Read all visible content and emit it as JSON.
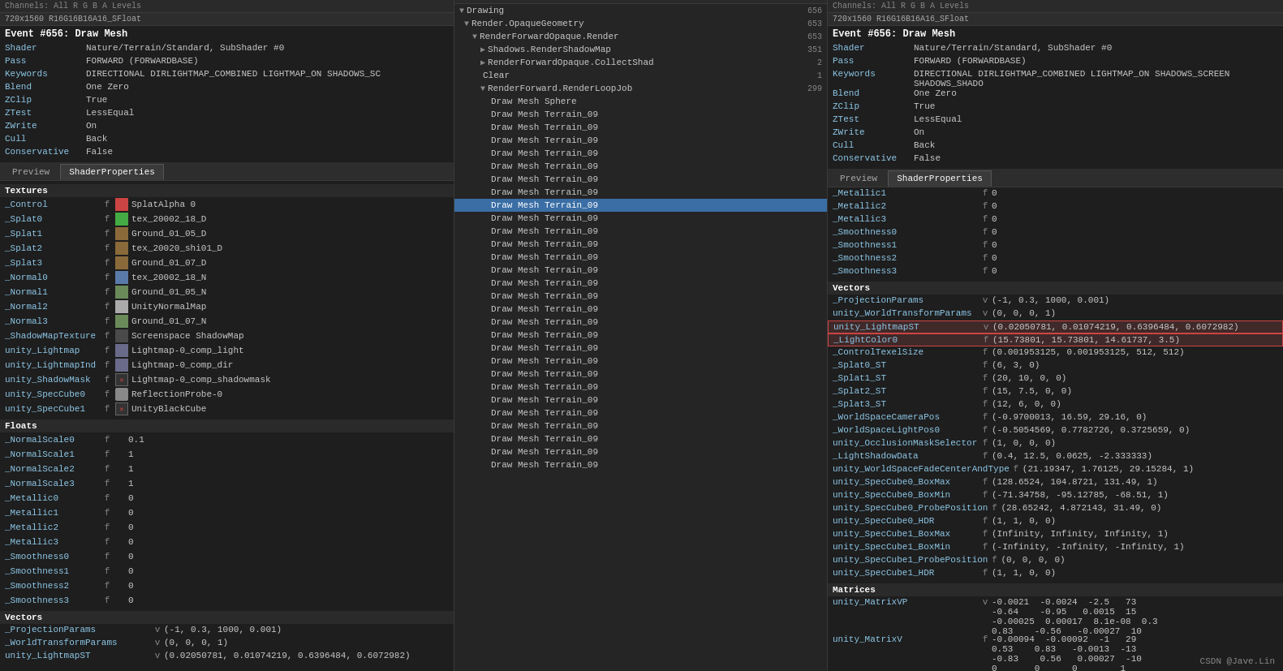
{
  "left": {
    "channelBar": "Channels: All  R  G  B  A  Levels",
    "resolution": "720x1560 R16G16B16A16_SFloat",
    "eventTitle": "Event #656: Draw Mesh",
    "properties": [
      {
        "key": "Shader",
        "val": "Nature/Terrain/Standard, SubShader #0"
      },
      {
        "key": "Pass",
        "val": "FORWARD (FORWARDBASE)"
      },
      {
        "key": "Keywords",
        "val": "DIRECTIONAL DIRLIGHTMAP_COMBINED LIGHTMAP_ON SHADOWS_SC"
      },
      {
        "key": "Blend",
        "val": "One Zero"
      },
      {
        "key": "ZClip",
        "val": "True"
      },
      {
        "key": "ZTest",
        "val": "LessEqual"
      },
      {
        "key": "ZWrite",
        "val": "On"
      },
      {
        "key": "Cull",
        "val": "Back"
      },
      {
        "key": "Conservative",
        "val": "False"
      }
    ],
    "tabs": [
      "Preview",
      "ShaderProperties"
    ],
    "activeTab": "ShaderProperties",
    "sections": {
      "textures": {
        "label": "Textures",
        "items": [
          {
            "name": "_Control",
            "type": "f",
            "thumb": "red",
            "val": "SplatAlpha 0"
          },
          {
            "name": "_Splat0",
            "type": "f",
            "thumb": "green",
            "val": "tex_20002_18_D"
          },
          {
            "name": "_Splat1",
            "type": "f",
            "thumb": "brown",
            "val": "Ground_01_05_D"
          },
          {
            "name": "_Splat2",
            "type": "f",
            "thumb": "brown2",
            "val": "tex_20020_shi01_D"
          },
          {
            "name": "_Splat3",
            "type": "f",
            "thumb": "brown3",
            "val": "Ground_01_07_D"
          },
          {
            "name": "_Normal0",
            "type": "f",
            "thumb": "blue",
            "val": "tex_20002_18_N"
          },
          {
            "name": "_Normal1",
            "type": "f",
            "thumb": "green2",
            "val": "Ground_01_05_N"
          },
          {
            "name": "_Normal2",
            "type": "f",
            "thumb": "gray",
            "val": "UnityNormalMap"
          },
          {
            "name": "_Normal3",
            "type": "f",
            "thumb": "gray2",
            "val": "Ground_01_07_N"
          },
          {
            "name": "_ShadowMapTexture",
            "type": "f",
            "thumb": "shadow",
            "val": "Screenspace ShadowMap"
          },
          {
            "name": "unity_Lightmap",
            "type": "f",
            "thumb": "lightmap",
            "val": "Lightmap-0_comp_light"
          },
          {
            "name": "unity_LightmapInd",
            "type": "f",
            "thumb": "lightmapdir",
            "val": "Lightmap-0_comp_dir"
          },
          {
            "name": "unity_ShadowMask",
            "type": "f",
            "thumb": "shadowmask",
            "val": "Lightmap-0_comp_shadowmask"
          },
          {
            "name": "unity_SpecCube0",
            "type": "f",
            "thumb": "cube",
            "val": "ReflectionProbe-0"
          },
          {
            "name": "unity_SpecCube1",
            "type": "f",
            "thumb": "xcube",
            "val": "UnityBlackCube"
          }
        ]
      },
      "floats": {
        "label": "Floats",
        "items": [
          {
            "name": "_NormalScale0",
            "type": "f",
            "val": "0.1"
          },
          {
            "name": "_NormalScale1",
            "type": "f",
            "val": "1"
          },
          {
            "name": "_NormalScale2",
            "type": "f",
            "val": "1"
          },
          {
            "name": "_NormalScale3",
            "type": "f",
            "val": "1"
          },
          {
            "name": "_Metallic0",
            "type": "f",
            "val": "0"
          },
          {
            "name": "_Metallic1",
            "type": "f",
            "val": "0"
          },
          {
            "name": "_Metallic2",
            "type": "f",
            "val": "0"
          },
          {
            "name": "_Metallic3",
            "type": "f",
            "val": "0"
          },
          {
            "name": "_Smoothness0",
            "type": "f",
            "val": "0"
          },
          {
            "name": "_Smoothness1",
            "type": "f",
            "val": "0"
          },
          {
            "name": "_Smoothness2",
            "type": "f",
            "val": "0"
          },
          {
            "name": "_Smoothness3",
            "type": "f",
            "val": "0"
          }
        ]
      },
      "vectors": {
        "label": "Vectors",
        "items": [
          {
            "name": "_ProjectionParams",
            "type": "v",
            "val": "(-1, 0.3, 1000, 0.001)"
          },
          {
            "name": "_WorldTransformParams",
            "type": "v",
            "val": "(0, 0, 0, 1)"
          },
          {
            "name": "unity_LightmapST",
            "type": "v",
            "val": "(0.02050781, 0.01074219, 0.6396484, 0.6072982)"
          }
        ]
      }
    }
  },
  "middle": {
    "treeItems": [
      {
        "label": "Drawing",
        "count": "656",
        "indent": 0,
        "arrow": "▼"
      },
      {
        "label": "Render.OpaqueGeometry",
        "count": "653",
        "indent": 1,
        "arrow": "▼"
      },
      {
        "label": "RenderForwardOpaque.Render",
        "count": "653",
        "indent": 2,
        "arrow": "▼"
      },
      {
        "label": "Shadows.RenderShadowMap",
        "count": "351",
        "indent": 3,
        "arrow": "▶"
      },
      {
        "label": "RenderForwardOpaque.CollectShad",
        "count": "2",
        "indent": 3,
        "arrow": "▶"
      },
      {
        "label": "Clear",
        "count": "1",
        "indent": 3,
        "arrow": ""
      },
      {
        "label": "RenderForward.RenderLoopJob",
        "count": "299",
        "indent": 3,
        "arrow": "▼"
      },
      {
        "label": "Draw Mesh Sphere",
        "count": "",
        "indent": 4,
        "arrow": ""
      },
      {
        "label": "Draw Mesh Terrain_09",
        "count": "",
        "indent": 4,
        "arrow": ""
      },
      {
        "label": "Draw Mesh Terrain_09",
        "count": "",
        "indent": 4,
        "arrow": ""
      },
      {
        "label": "Draw Mesh Terrain_09",
        "count": "",
        "indent": 4,
        "arrow": ""
      },
      {
        "label": "Draw Mesh Terrain_09",
        "count": "",
        "indent": 4,
        "arrow": ""
      },
      {
        "label": "Draw Mesh Terrain_09",
        "count": "",
        "indent": 4,
        "arrow": ""
      },
      {
        "label": "Draw Mesh Terrain_09",
        "count": "",
        "indent": 4,
        "arrow": ""
      },
      {
        "label": "Draw Mesh Terrain_09",
        "count": "",
        "indent": 4,
        "arrow": ""
      },
      {
        "label": "Draw Mesh Terrain_09",
        "count": "",
        "indent": 4,
        "selected": true,
        "arrow": ""
      },
      {
        "label": "Draw Mesh Terrain_09",
        "count": "",
        "indent": 4,
        "arrow": ""
      },
      {
        "label": "Draw Mesh Terrain_09",
        "count": "",
        "indent": 4,
        "arrow": ""
      },
      {
        "label": "Draw Mesh Terrain_09",
        "count": "",
        "indent": 4,
        "arrow": ""
      },
      {
        "label": "Draw Mesh Terrain_09",
        "count": "",
        "indent": 4,
        "arrow": ""
      },
      {
        "label": "Draw Mesh Terrain_09",
        "count": "",
        "indent": 4,
        "arrow": ""
      },
      {
        "label": "Draw Mesh Terrain_09",
        "count": "",
        "indent": 4,
        "arrow": ""
      },
      {
        "label": "Draw Mesh Terrain_09",
        "count": "",
        "indent": 4,
        "arrow": ""
      },
      {
        "label": "Draw Mesh Terrain_09",
        "count": "",
        "indent": 4,
        "arrow": ""
      },
      {
        "label": "Draw Mesh Terrain_09",
        "count": "",
        "indent": 4,
        "arrow": ""
      },
      {
        "label": "Draw Mesh Terrain_09",
        "count": "",
        "indent": 4,
        "arrow": ""
      },
      {
        "label": "Draw Mesh Terrain_09",
        "count": "",
        "indent": 4,
        "arrow": ""
      },
      {
        "label": "Draw Mesh Terrain_09",
        "count": "",
        "indent": 4,
        "arrow": ""
      },
      {
        "label": "Draw Mesh Terrain_09",
        "count": "",
        "indent": 4,
        "arrow": ""
      },
      {
        "label": "Draw Mesh Terrain_09",
        "count": "",
        "indent": 4,
        "arrow": ""
      },
      {
        "label": "Draw Mesh Terrain_09",
        "count": "",
        "indent": 4,
        "arrow": ""
      },
      {
        "label": "Draw Mesh Terrain_09",
        "count": "",
        "indent": 4,
        "arrow": ""
      },
      {
        "label": "Draw Mesh Terrain_09",
        "count": "",
        "indent": 4,
        "arrow": ""
      },
      {
        "label": "Draw Mesh Terrain_09",
        "count": "",
        "indent": 4,
        "arrow": ""
      },
      {
        "label": "Draw Mesh Terrain_09",
        "count": "",
        "indent": 4,
        "arrow": ""
      },
      {
        "label": "Draw Mesh Terrain_09",
        "count": "",
        "indent": 4,
        "arrow": ""
      }
    ]
  },
  "right": {
    "channelBar": "Channels: All  R  G  B  A  Levels",
    "resolution": "720x1560 R16G16B16A16_SFloat",
    "eventTitle": "Event #656: Draw Mesh",
    "properties": [
      {
        "key": "Shader",
        "val": "Nature/Terrain/Standard, SubShader #0"
      },
      {
        "key": "Pass",
        "val": "FORWARD (FORWARDBASE)"
      },
      {
        "key": "Keywords",
        "val": "DIRECTIONAL DIRLIGHTMAP_COMBINED LIGHTMAP_ON SHADOWS_SCREEN SHADOWS_SHADO"
      },
      {
        "key": "Blend",
        "val": "One Zero"
      },
      {
        "key": "ZClip",
        "val": "True"
      },
      {
        "key": "ZTest",
        "val": "LessEqual"
      },
      {
        "key": "ZWrite",
        "val": "On"
      },
      {
        "key": "Cull",
        "val": "Back"
      },
      {
        "key": "Conservative",
        "val": "False"
      }
    ],
    "tabs": [
      "Preview",
      "ShaderProperties"
    ],
    "activeTab": "ShaderProperties",
    "scrolledProps": [
      {
        "name": "_Metallic1",
        "type": "f",
        "val": "0"
      },
      {
        "name": "_Metallic2",
        "type": "f",
        "val": "0"
      },
      {
        "name": "_Metallic3",
        "type": "f",
        "val": "0"
      },
      {
        "name": "_Smoothness0",
        "type": "f",
        "val": "0"
      },
      {
        "name": "_Smoothness1",
        "type": "f",
        "val": "0"
      },
      {
        "name": "_Smoothness2",
        "type": "f",
        "val": "0"
      },
      {
        "name": "_Smoothness3",
        "type": "f",
        "val": "0"
      }
    ],
    "vectorsSection": {
      "label": "Vectors",
      "items": [
        {
          "name": "_ProjectionParams",
          "type": "v",
          "val": "(-1, 0.3, 1000, 0.001)",
          "highlight": false
        },
        {
          "name": "unity_WorldTransformParams",
          "type": "v",
          "val": "(0, 0, 0, 1)",
          "highlight": false
        },
        {
          "name": "unity_LightmapST",
          "type": "v",
          "val": "(0.02050781, 0.01074219, 0.6396484, 0.6072982)",
          "highlight": true
        },
        {
          "name": "_LightColor0",
          "type": "f",
          "val": "(15.73801, 15.73801, 14.61737, 3.5)",
          "highlight": true
        },
        {
          "name": "_ControlTexelSize",
          "type": "f",
          "val": "(0.001953125, 0.001953125, 512, 512)",
          "highlight": false
        },
        {
          "name": "_Splat0_ST",
          "type": "f",
          "val": "(6, 3, 0)",
          "highlight": false
        },
        {
          "name": "_Splat1_ST",
          "type": "f",
          "val": "(20, 10, 0, 0)",
          "highlight": false
        },
        {
          "name": "_Splat2_ST",
          "type": "f",
          "val": "(15, 7.5, 0, 0)",
          "highlight": false
        },
        {
          "name": "_Splat3_ST",
          "type": "f",
          "val": "(12, 6, 0, 0)",
          "highlight": false
        },
        {
          "name": "_WorldSpaceCameraPos",
          "type": "f",
          "val": "(-0.9700013, 16.59, 29.16, 0)",
          "highlight": false
        },
        {
          "name": "_WorldSpaceLightPos0",
          "type": "f",
          "val": "(-0.5054569, 0.7782726, 0.3725659, 0)",
          "highlight": false
        },
        {
          "name": "unity_OcclusionMaskSelector",
          "type": "f",
          "val": "(1, 0, 0, 0)",
          "highlight": false
        },
        {
          "name": "_LightShadowData",
          "type": "f",
          "val": "(0.4, 12.5, 0.0625, -2.333333)",
          "highlight": false
        },
        {
          "name": "unity_WorldSpaceFadeCenterAndType",
          "type": "f",
          "val": "(21.19347, 1.76125, 29.15284, 1)",
          "highlight": false
        },
        {
          "name": "unity_SpecCube0_BoxMax",
          "type": "f",
          "val": "(128.6524, 104.8721, 131.49, 1)",
          "highlight": false
        },
        {
          "name": "unity_SpecCube0_BoxMin",
          "type": "f",
          "val": "(-71.34758, -95.12785, -68.51, 1)",
          "highlight": false
        },
        {
          "name": "unity_SpecCube0_ProbePosition",
          "type": "f",
          "val": "(28.65242, 4.872143, 31.49, 0)",
          "highlight": false
        },
        {
          "name": "unity_SpecCube0_HDR",
          "type": "f",
          "val": "(1, 1, 0, 0)",
          "highlight": false
        },
        {
          "name": "unity_SpecCube1_BoxMax",
          "type": "f",
          "val": "(Infinity, Infinity, Infinity, 1)",
          "highlight": false
        },
        {
          "name": "unity_SpecCube1_BoxMin",
          "type": "f",
          "val": "(-Infinity, -Infinity, -Infinity, 1)",
          "highlight": false
        },
        {
          "name": "unity_SpecCube1_ProbePosition",
          "type": "f",
          "val": "(0, 0, 0, 0)",
          "highlight": false
        },
        {
          "name": "unity_SpecCube1_HDR",
          "type": "f",
          "val": "(1, 1, 0, 0)",
          "highlight": false
        }
      ]
    },
    "matricesSection": {
      "label": "Matrices",
      "items": [
        {
          "name": "unity_MatrixVP",
          "type": "v",
          "val": "-0.0021  -0.0024  -2.5   73\n-0.64    -0.95   0.0015  15\n-0.00025  0.00017  8.1e-08  0.3\n0.83    -0.56   -0.00027  10"
        },
        {
          "name": "unity_MatrixV",
          "type": "f",
          "val": "-0.00094  -0.00092  -1   29\n0.53    0.83   -0.0013  -13\n-0.83    0.56   0.00027  -10\n0       0      0        1"
        }
      ]
    }
  },
  "watermark": "CSDN @Jave.Lin"
}
